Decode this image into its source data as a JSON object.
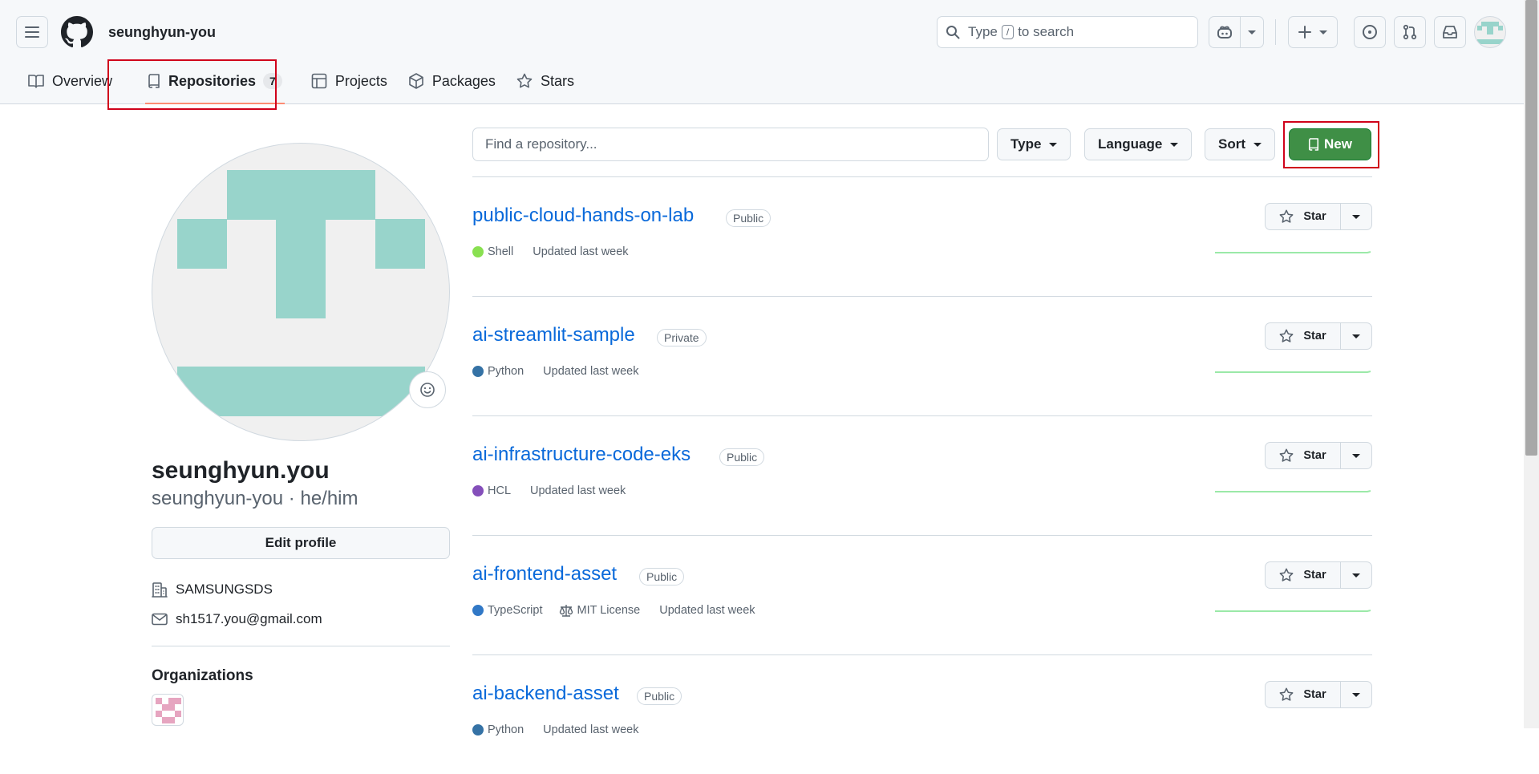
{
  "header": {
    "owner": "seunghyun-you",
    "search": {
      "prefix": "Type",
      "key": "/",
      "suffix": "to search"
    }
  },
  "tabs": [
    {
      "label": "Overview",
      "icon": "book-icon"
    },
    {
      "label": "Repositories",
      "icon": "repo-icon",
      "count": "7",
      "selected": true
    },
    {
      "label": "Projects",
      "icon": "table-icon"
    },
    {
      "label": "Packages",
      "icon": "package-icon"
    },
    {
      "label": "Stars",
      "icon": "star-icon"
    }
  ],
  "profile": {
    "fullname": "seunghyun.you",
    "username": "seunghyun-you",
    "pronouns": "he/him",
    "separator": "·",
    "edit_label": "Edit profile",
    "company": "SAMSUNGSDS",
    "email": "sh1517.you@gmail.com",
    "organizations_heading": "Organizations"
  },
  "filters": {
    "search_placeholder": "Find a repository...",
    "type_label": "Type",
    "language_label": "Language",
    "sort_label": "Sort",
    "new_label": "New"
  },
  "repos": [
    {
      "name": "public-cloud-hands-on-lab",
      "visibility": "Public",
      "language": "Shell",
      "lang_color": "#89e051",
      "updated": "Updated last week",
      "star_label": "Star"
    },
    {
      "name": "ai-streamlit-sample",
      "visibility": "Private",
      "language": "Python",
      "lang_color": "#3572A5",
      "updated": "Updated last week",
      "star_label": "Star"
    },
    {
      "name": "ai-infrastructure-code-eks",
      "visibility": "Public",
      "language": "HCL",
      "lang_color": "#844FBA",
      "updated": "Updated last week",
      "star_label": "Star"
    },
    {
      "name": "ai-frontend-asset",
      "visibility": "Public",
      "language": "TypeScript",
      "lang_color": "#3178c6",
      "license": "MIT License",
      "updated": "Updated last week",
      "star_label": "Star"
    },
    {
      "name": "ai-backend-asset",
      "visibility": "Public",
      "language": "Python",
      "lang_color": "#3572A5",
      "updated": "Updated last week",
      "star_label": "Star"
    }
  ],
  "colors": {
    "accent": "#0969da",
    "new_button": "#3f8f46",
    "highlight": "#d0021b",
    "tab_underline": "#fd8c73",
    "avatar": "#98d4cb"
  }
}
